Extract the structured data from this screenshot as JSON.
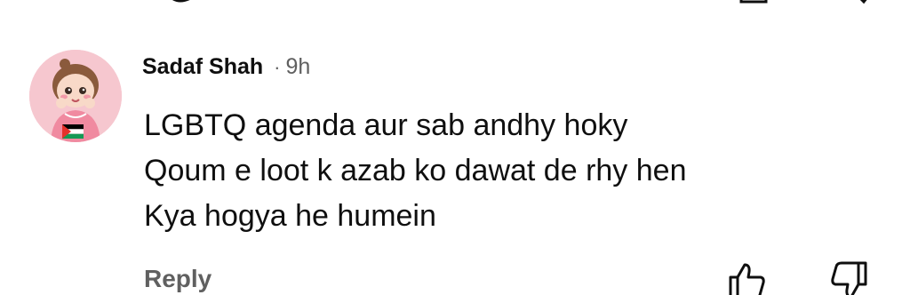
{
  "comment": {
    "author": "Sadaf Shah",
    "separator": "·",
    "time": "9h",
    "lines": [
      "LGBTQ agenda aur sab andhy hoky",
      "Qoum e loot k azab ko dawat de rhy hen",
      "Kya hogya he humein"
    ],
    "reply_label": "Reply",
    "avatar_icon": "avatar-cartoon-girl",
    "flag_icon": "palestine-flag-icon"
  },
  "toolbar": {
    "like_icon": "thumbs-up-icon",
    "dislike_icon": "thumbs-down-icon"
  },
  "colors": {
    "text": "#0f0f0f",
    "secondary_text": "#606060",
    "avatar_bg": "#f6c7cf"
  }
}
